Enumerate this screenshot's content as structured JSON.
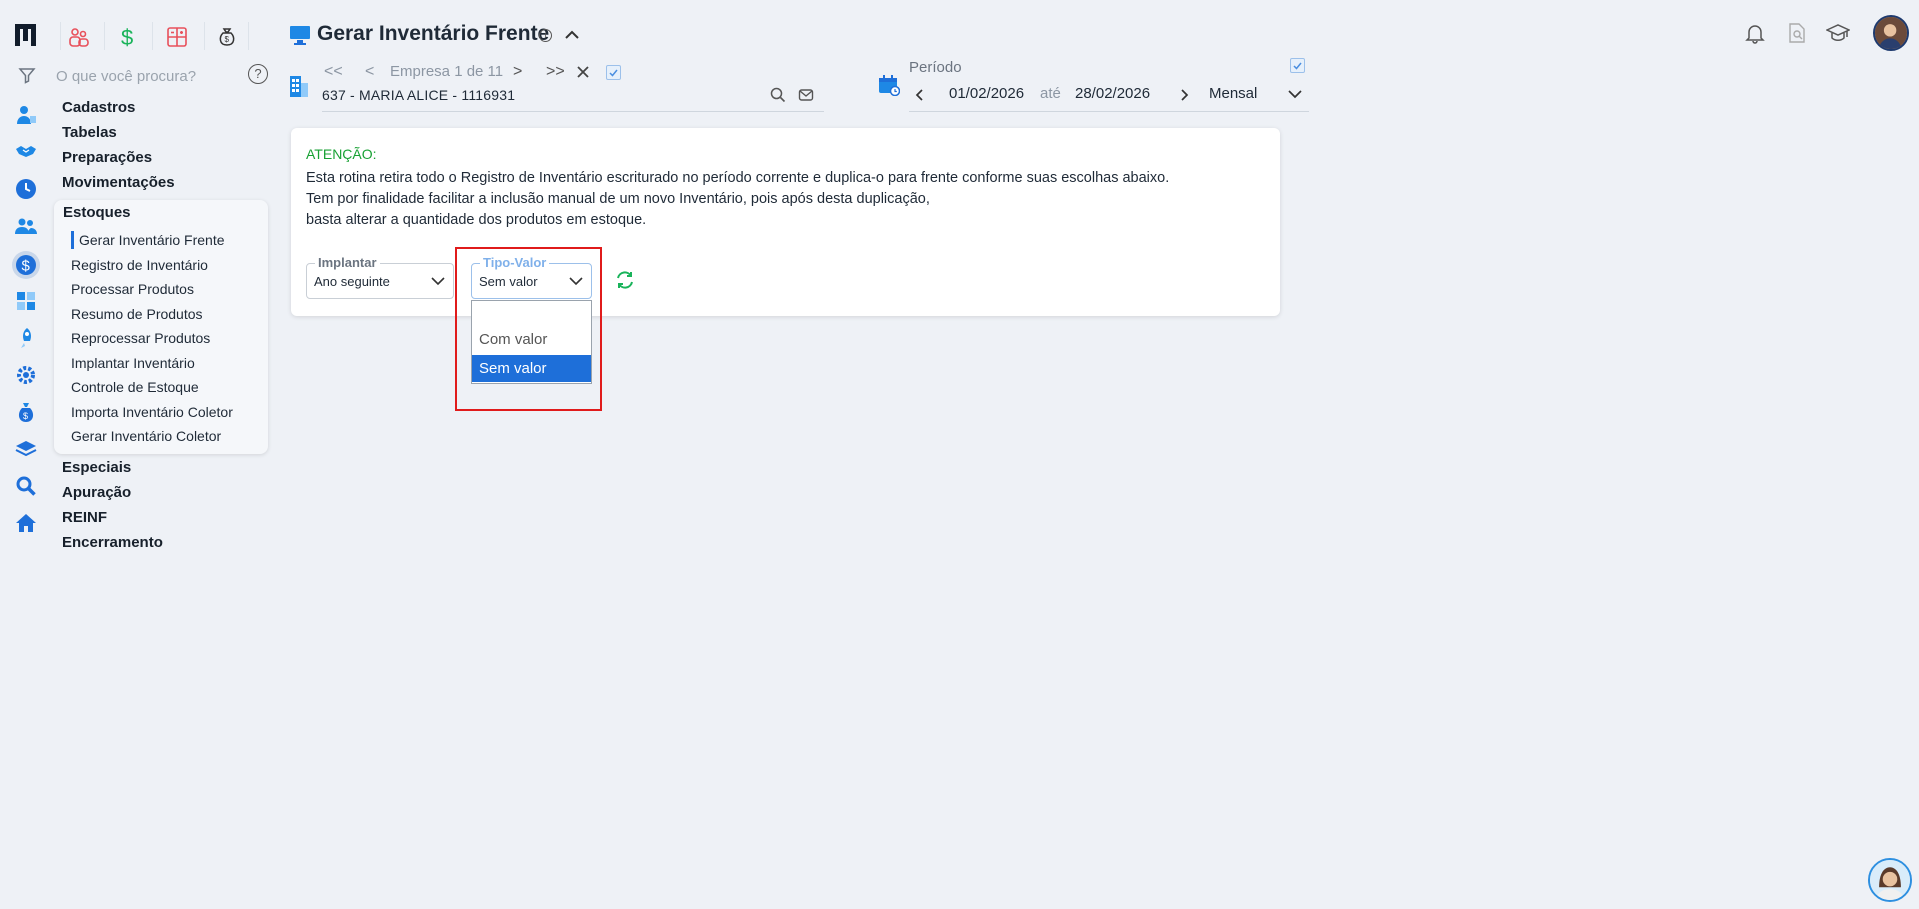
{
  "top_apps": [
    "people-group-icon",
    "dollar-icon",
    "calculator-grid-icon",
    "money-bag-icon"
  ],
  "search": {
    "placeholder": "O que você procura?"
  },
  "help_icon": "?",
  "menu": {
    "groups_top": [
      "Cadastros",
      "Tabelas",
      "Preparações",
      "Movimentações"
    ],
    "open_group": "Estoques",
    "open_items": [
      "Gerar Inventário Frente",
      "Registro de Inventário",
      "Processar Produtos",
      "Resumo de Produtos",
      "Reprocessar Produtos",
      "Implantar Inventário",
      "Controle de Estoque",
      "Importa Inventário Coletor",
      "Gerar Inventário Coletor"
    ],
    "groups_bottom": [
      "Especiais",
      "Apuração",
      "REINF",
      "Encerramento"
    ]
  },
  "header": {
    "title": "Gerar Inventário Frente",
    "company_nav": {
      "first": "<<",
      "prev": "<",
      "label": "Empresa 1 de 11",
      "next": ">",
      "last": ">>"
    },
    "company": "637 - MARIA ALICE - 1116931",
    "period": {
      "label": "Período",
      "start": "01/02/2026",
      "connector": "até",
      "end": "28/02/2026",
      "mode": "Mensal"
    }
  },
  "card": {
    "attention": "ATENÇÃO:",
    "lines": [
      "Esta rotina retira todo o Registro de Inventário escriturado no período corrente e duplica-o para frente conforme suas escolhas abaixo.",
      "Tem por finalidade facilitar a inclusão manual de um novo Inventário, pois após desta duplicação,",
      "basta alterar a quantidade dos produtos em estoque."
    ],
    "implantar": {
      "label": "Implantar",
      "value": "Ano seguinte"
    },
    "tipo_valor": {
      "label": "Tipo-Valor",
      "value": "Sem valor",
      "options": [
        "",
        "Com valor",
        "Sem valor"
      ],
      "selected_index": 2
    }
  },
  "colors": {
    "accent": "#1e6fd9",
    "attention": "#18a134",
    "highlight": "#e01b1b",
    "refresh": "#19b35a"
  }
}
